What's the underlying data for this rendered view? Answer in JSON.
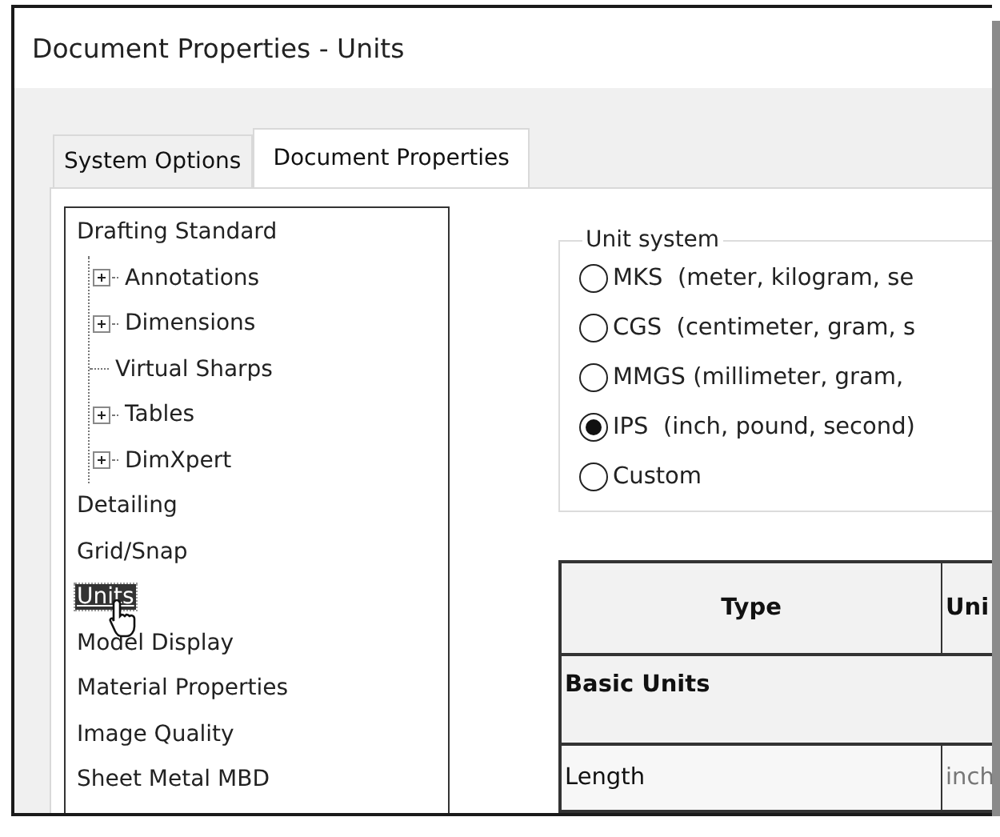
{
  "window": {
    "title": "Document Properties - Units"
  },
  "tabs": [
    {
      "label": "System Options",
      "selected": false
    },
    {
      "label": "Document Properties",
      "selected": true
    }
  ],
  "tree": {
    "items": [
      {
        "label": "Drafting Standard",
        "selected": false,
        "children": [
          {
            "label": "Annotations",
            "selected": false,
            "expanded": false
          },
          {
            "label": "Dimensions",
            "selected": false,
            "expanded": false
          },
          {
            "label": "Virtual Sharps",
            "selected": false
          },
          {
            "label": "Tables",
            "selected": false,
            "expanded": false
          },
          {
            "label": "DimXpert",
            "selected": false,
            "expanded": false
          }
        ]
      },
      {
        "label": "Detailing",
        "selected": false
      },
      {
        "label": "Grid/Snap",
        "selected": false
      },
      {
        "label": "Units",
        "selected": true
      },
      {
        "label": "Model Display",
        "selected": false
      },
      {
        "label": "Material Properties",
        "selected": false
      },
      {
        "label": "Image Quality",
        "selected": false
      },
      {
        "label": "Sheet Metal MBD",
        "selected": false
      }
    ]
  },
  "unit_system": {
    "legend": "Unit system",
    "options": [
      {
        "label": "MKS  (meter, kilogram, se",
        "selected": false
      },
      {
        "label": "CGS  (centimeter, gram, s",
        "selected": false
      },
      {
        "label": "MMGS (millimeter, gram,",
        "selected": false
      },
      {
        "label": "IPS  (inch, pound, second)",
        "selected": true
      },
      {
        "label": "Custom",
        "selected": false
      }
    ]
  },
  "table": {
    "columns": [
      "Type",
      "Uni"
    ],
    "rows": [
      {
        "kind": "section",
        "cells": [
          "Basic Units"
        ]
      },
      {
        "kind": "row",
        "cells": [
          "Length",
          "inch"
        ]
      }
    ]
  }
}
